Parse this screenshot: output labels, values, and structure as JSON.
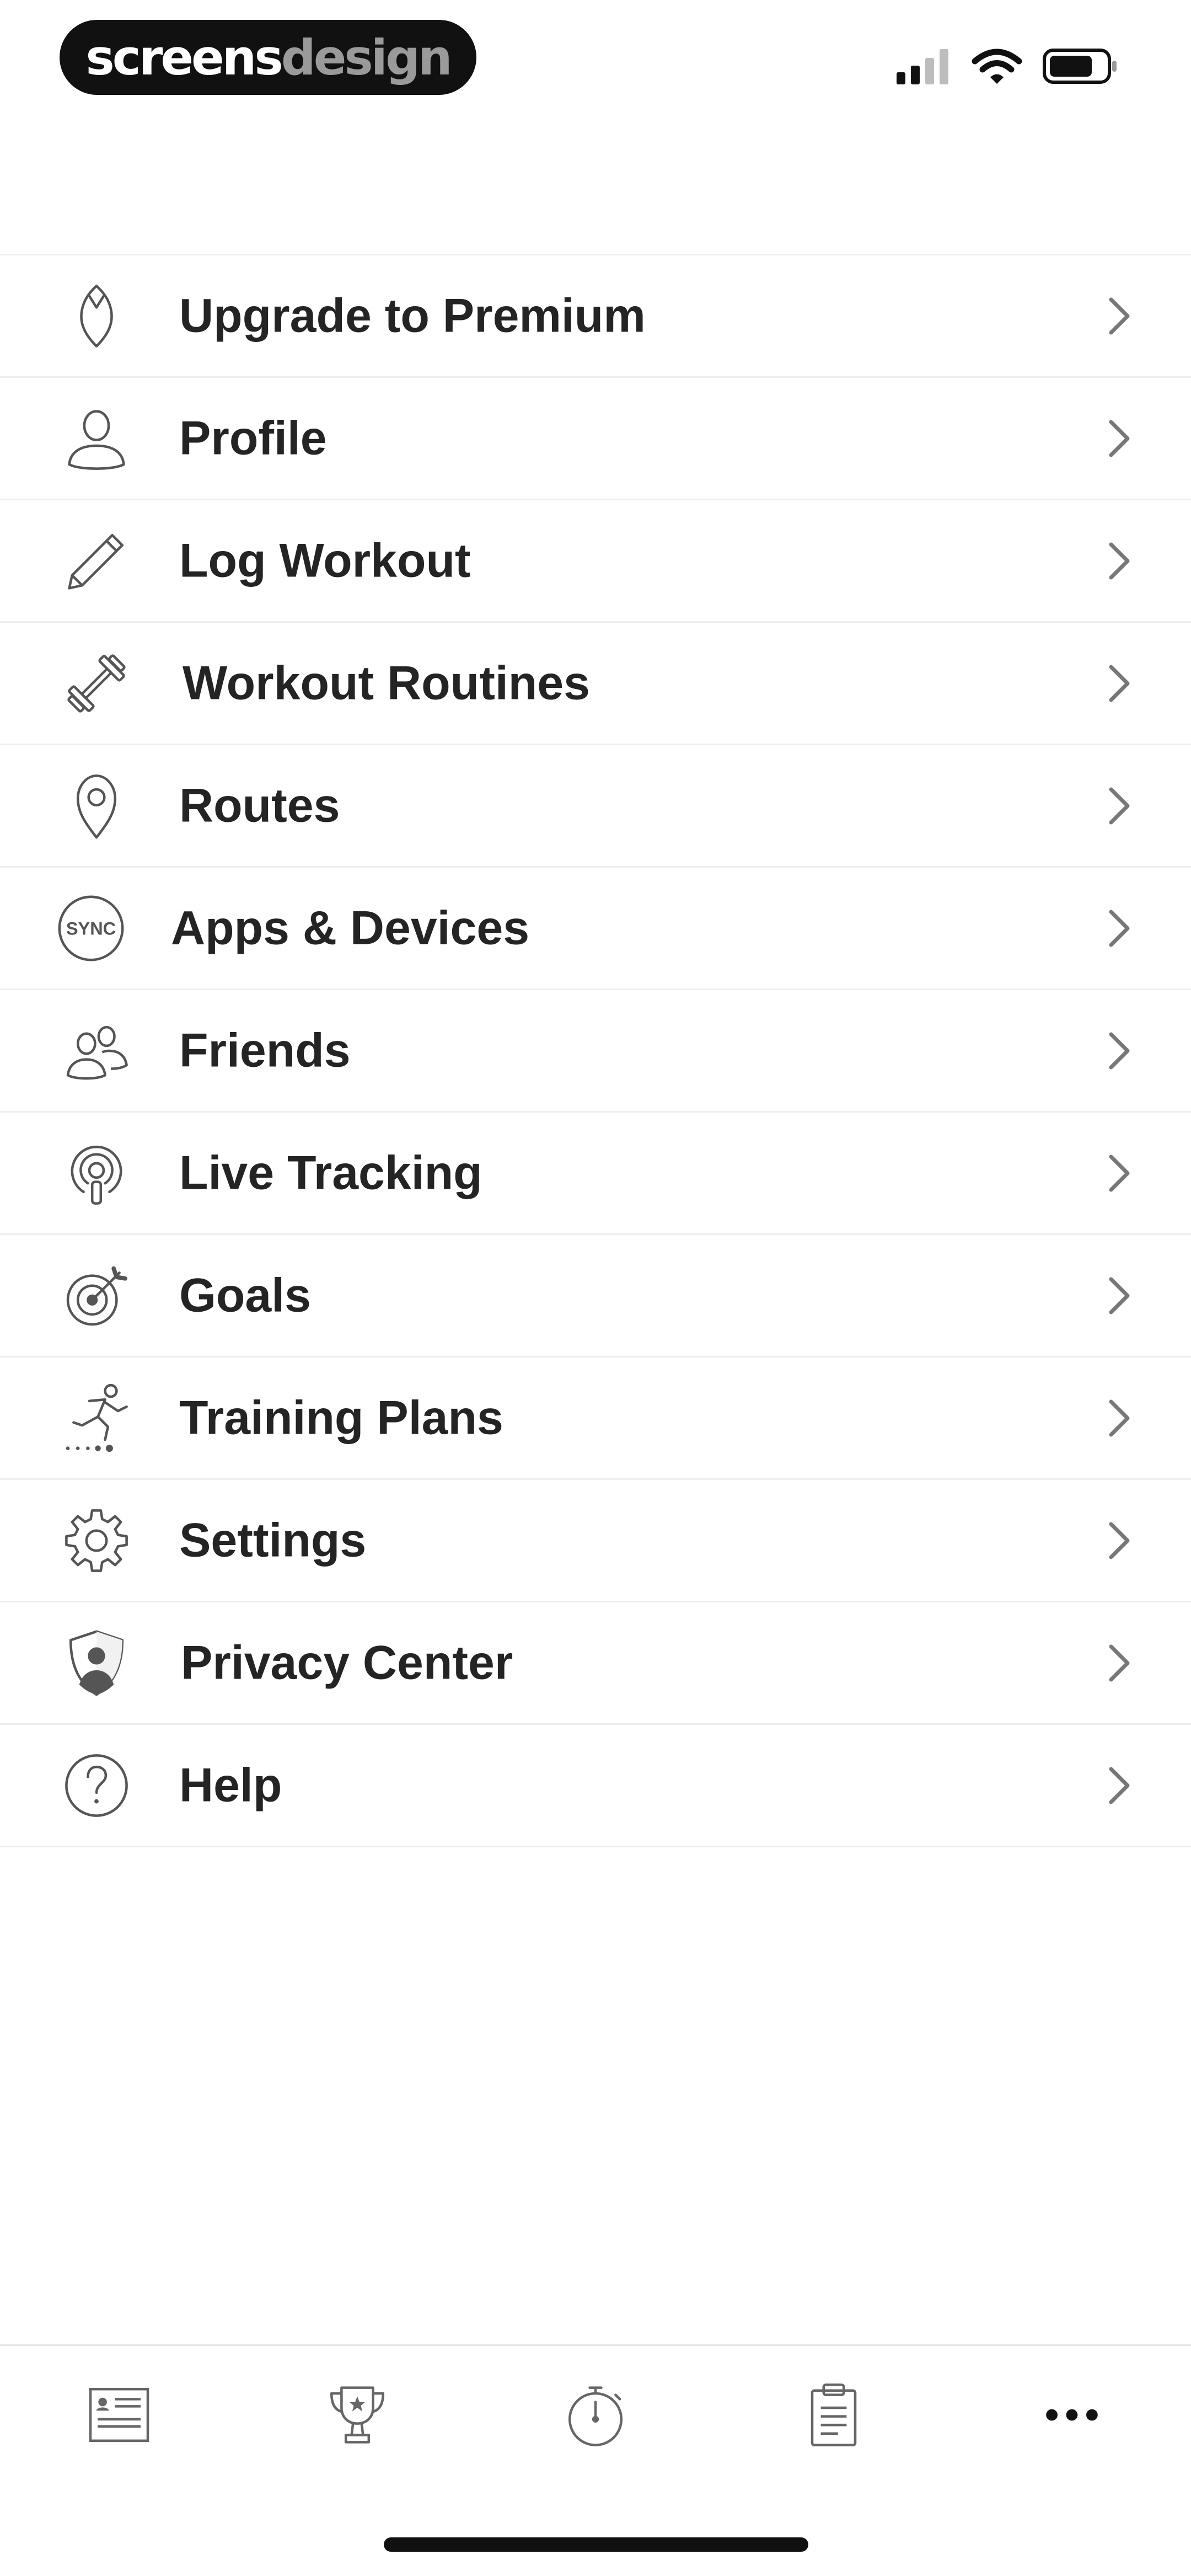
{
  "status_bar": {
    "logo_part1": "screens",
    "logo_part2": "design"
  },
  "menu": {
    "items": [
      {
        "label": "Upgrade to Premium",
        "icon": "premium-icon"
      },
      {
        "label": "Profile",
        "icon": "user-icon"
      },
      {
        "label": "Log Workout",
        "icon": "pencil-icon"
      },
      {
        "label": "Workout Routines",
        "icon": "dumbbell-icon"
      },
      {
        "label": "Routes",
        "icon": "map-pin-icon"
      },
      {
        "label": "Apps & Devices",
        "icon": "sync-icon",
        "icon_text": "SYNC"
      },
      {
        "label": "Friends",
        "icon": "friends-icon"
      },
      {
        "label": "Live Tracking",
        "icon": "live-tracking-icon"
      },
      {
        "label": "Goals",
        "icon": "target-icon"
      },
      {
        "label": "Training Plans",
        "icon": "running-man-icon"
      },
      {
        "label": "Settings",
        "icon": "gear-icon"
      },
      {
        "label": "Privacy Center",
        "icon": "shield-user-icon"
      },
      {
        "label": "Help",
        "icon": "question-icon"
      }
    ]
  },
  "tab_bar": {
    "tabs": [
      {
        "name": "feed",
        "icon": "feed-icon"
      },
      {
        "name": "challenges",
        "icon": "trophy-icon"
      },
      {
        "name": "record",
        "icon": "stopwatch-icon"
      },
      {
        "name": "plans",
        "icon": "clipboard-icon"
      },
      {
        "name": "more",
        "icon": "more-icon",
        "selected": true
      }
    ]
  },
  "colors": {
    "text": "#242424",
    "icon": "#555555",
    "divider": "#eeeeee",
    "chevron": "#777777"
  }
}
